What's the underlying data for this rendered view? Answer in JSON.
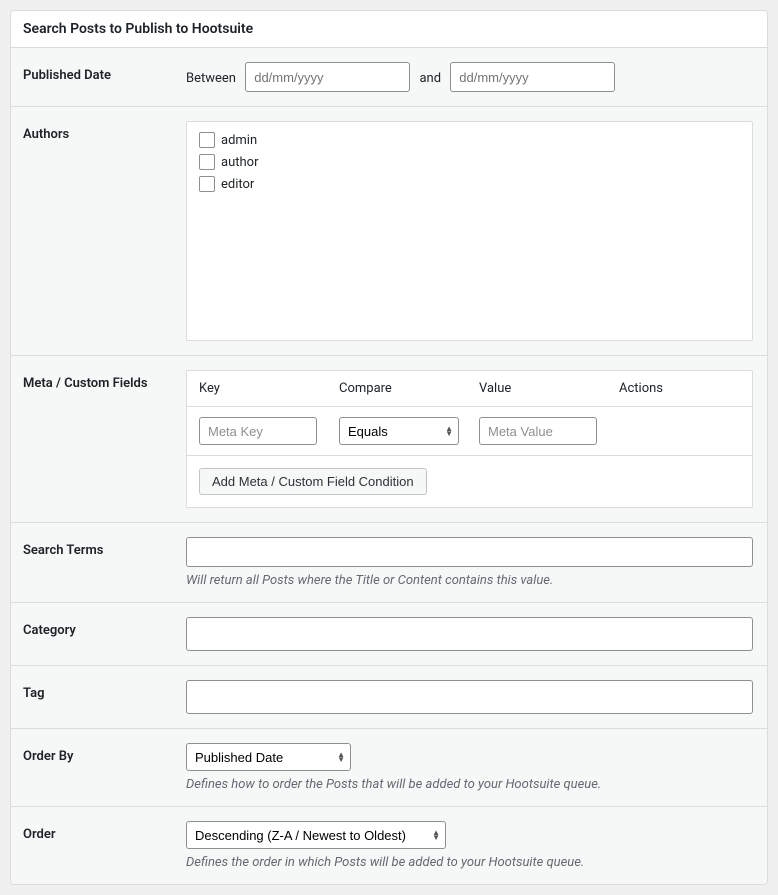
{
  "header": {
    "title": "Search Posts to Publish to Hootsuite"
  },
  "publishedDate": {
    "label": "Published Date",
    "betweenLabel": "Between",
    "andLabel": "and",
    "placeholder": "dd/mm/yyyy"
  },
  "authors": {
    "label": "Authors",
    "items": [
      {
        "name": "admin"
      },
      {
        "name": "author"
      },
      {
        "name": "editor"
      }
    ]
  },
  "metaFields": {
    "label": "Meta / Custom Fields",
    "columns": {
      "key": "Key",
      "compare": "Compare",
      "value": "Value",
      "actions": "Actions"
    },
    "keyPlaceholder": "Meta Key",
    "valuePlaceholder": "Meta Value",
    "compareSelected": "Equals",
    "addButton": "Add Meta / Custom Field Condition"
  },
  "searchTerms": {
    "label": "Search Terms",
    "description": "Will return all Posts where the Title or Content contains this value."
  },
  "category": {
    "label": "Category"
  },
  "tag": {
    "label": "Tag"
  },
  "orderBy": {
    "label": "Order By",
    "selected": "Published Date",
    "description": "Defines how to order the Posts that will be added to your Hootsuite queue."
  },
  "order": {
    "label": "Order",
    "selected": "Descending (Z-A / Newest to Oldest)",
    "description": "Defines the order in which Posts will be added to your Hootsuite queue."
  }
}
